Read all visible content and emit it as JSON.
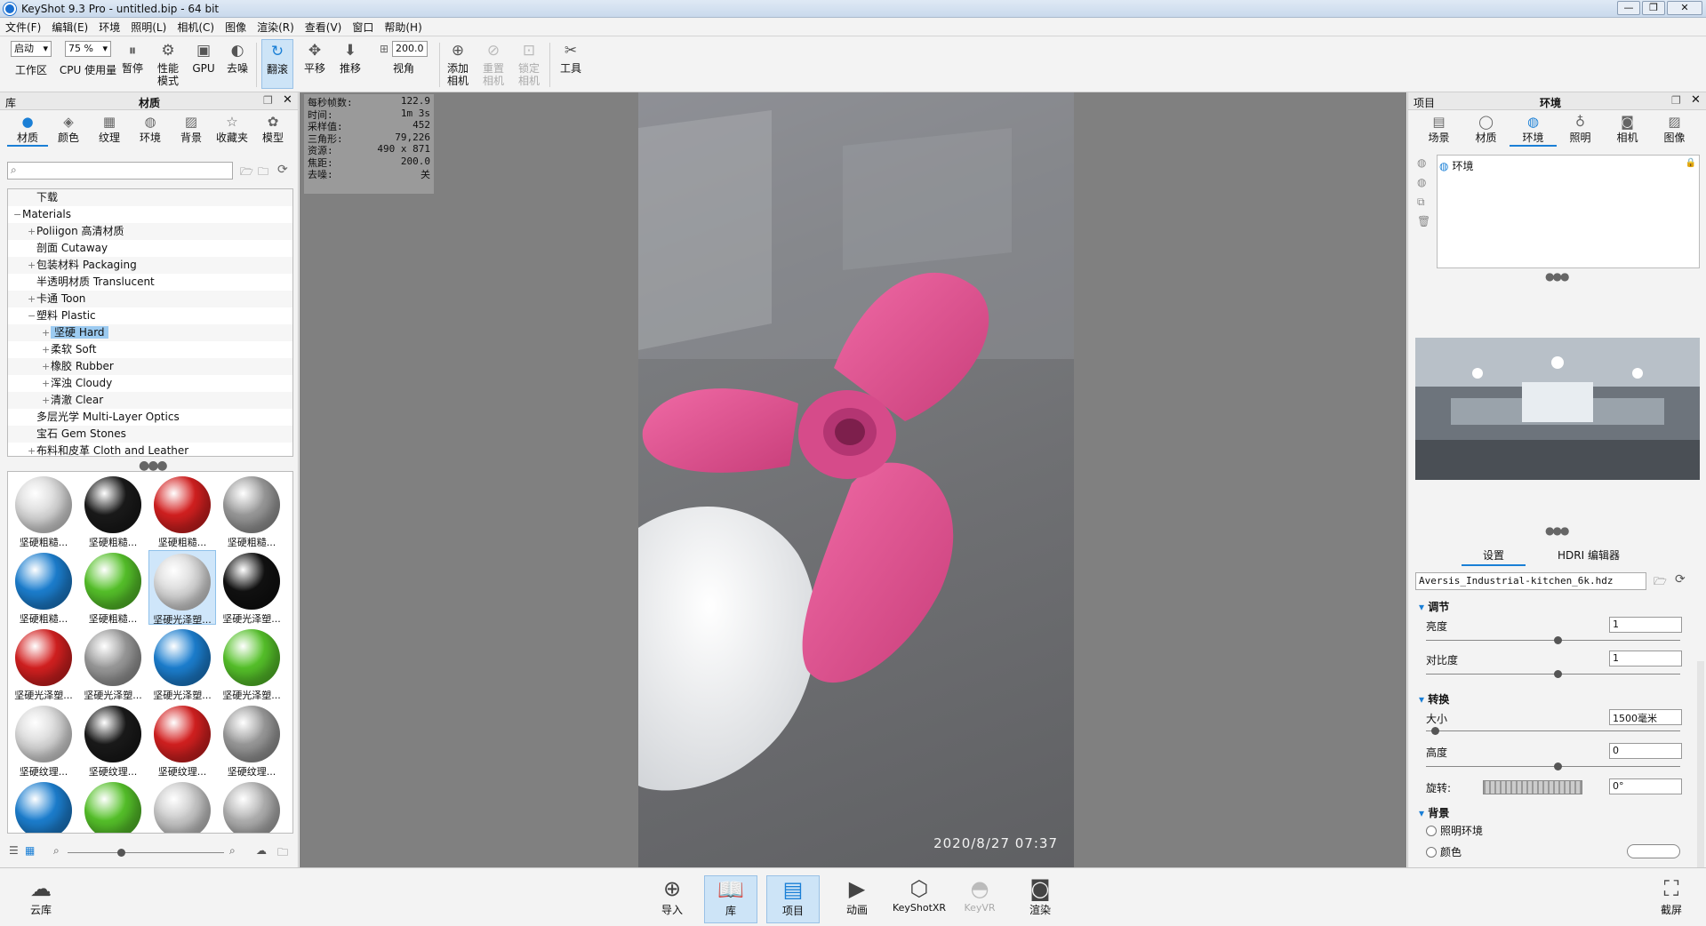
{
  "window": {
    "title": "KeyShot 9.3 Pro  - untitled.bip  - 64 bit",
    "minimize": "—",
    "restore": "❐",
    "close": "✕"
  },
  "menu": [
    "文件(F)",
    "编辑(E)",
    "环境",
    "照明(L)",
    "相机(C)",
    "图像",
    "渲染(R)",
    "查看(V)",
    "窗口",
    "帮助(H)"
  ],
  "toolbar": {
    "workspace_select": "启动",
    "workspace_label": "工作区",
    "cpu_select": "75 %",
    "cpu_label": "CPU 使用量",
    "pause_label": "暂停",
    "perf_label": "性能模式",
    "gpu_label": "GPU",
    "denoise_label": "去噪",
    "tumble_label": "翻滚",
    "pan_label": "平移",
    "dolly_label": "推移",
    "fov_value": "200.0",
    "fov_label": "视角",
    "add_cam_label": "添加相机",
    "reset_cam_label": "重置相机",
    "lock_cam_label": "锁定相机",
    "tools_label": "工具"
  },
  "library": {
    "panel_title": "库",
    "tab_title": "材质",
    "tabs": [
      "材质",
      "颜色",
      "纹理",
      "环境",
      "背景",
      "收藏夹",
      "模型"
    ],
    "tree": [
      {
        "label": "下载",
        "indent": 1,
        "pm": ""
      },
      {
        "label": "Materials",
        "indent": 0,
        "pm": "−"
      },
      {
        "label": "Poliigon 高清材质",
        "indent": 1,
        "pm": "+"
      },
      {
        "label": "剖面 Cutaway",
        "indent": 1,
        "pm": ""
      },
      {
        "label": "包装材料 Packaging",
        "indent": 1,
        "pm": "+"
      },
      {
        "label": "半透明材质 Translucent",
        "indent": 1,
        "pm": ""
      },
      {
        "label": "卡通 Toon",
        "indent": 1,
        "pm": "+"
      },
      {
        "label": "塑料 Plastic",
        "indent": 1,
        "pm": "−"
      },
      {
        "label": "坚硬 Hard",
        "indent": 2,
        "pm": "+",
        "selected": true
      },
      {
        "label": "柔软 Soft",
        "indent": 2,
        "pm": "+"
      },
      {
        "label": "橡胶 Rubber",
        "indent": 2,
        "pm": "+"
      },
      {
        "label": "浑浊 Cloudy",
        "indent": 2,
        "pm": "+"
      },
      {
        "label": "清澈 Clear",
        "indent": 2,
        "pm": "+"
      },
      {
        "label": "多层光学 Multi-Layer Optics",
        "indent": 1,
        "pm": ""
      },
      {
        "label": "宝石 Gem Stones",
        "indent": 1,
        "pm": ""
      },
      {
        "label": "布料和皮革 Cloth and Leather",
        "indent": 1,
        "pm": "+"
      }
    ],
    "thumbs": [
      {
        "label": "坚硬粗糙...",
        "color": "#d9d9d9"
      },
      {
        "label": "坚硬粗糙...",
        "color": "#1a1a1a"
      },
      {
        "label": "坚硬粗糙...",
        "color": "#d42020"
      },
      {
        "label": "坚硬粗糙...",
        "color": "#9a9a9a"
      },
      {
        "label": "坚硬粗糙...",
        "color": "#1c7fd0"
      },
      {
        "label": "坚硬粗糙...",
        "color": "#56c22a"
      },
      {
        "label": "坚硬光泽塑...",
        "color": "#d9d9d9",
        "selected": true
      },
      {
        "label": "坚硬光泽塑...",
        "color": "#111111"
      },
      {
        "label": "坚硬光泽塑...",
        "color": "#d42020"
      },
      {
        "label": "坚硬光泽塑...",
        "color": "#9a9a9a"
      },
      {
        "label": "坚硬光泽塑...",
        "color": "#1c7fd0"
      },
      {
        "label": "坚硬光泽塑...",
        "color": "#56c22a"
      },
      {
        "label": "坚硬纹理...",
        "color": "#d9d9d9"
      },
      {
        "label": "坚硬纹理...",
        "color": "#1a1a1a"
      },
      {
        "label": "坚硬纹理...",
        "color": "#d42020"
      },
      {
        "label": "坚硬纹理...",
        "color": "#9a9a9a"
      },
      {
        "label": "",
        "color": "#1c7fd0"
      },
      {
        "label": "",
        "color": "#56c22a"
      },
      {
        "label": "",
        "color": "#c8c8c8"
      },
      {
        "label": "",
        "color": "#b0b0b0"
      }
    ]
  },
  "stats": [
    {
      "k": "每秒帧数:",
      "v": "122.9"
    },
    {
      "k": "时间:",
      "v": "1m 3s"
    },
    {
      "k": "采样值:",
      "v": "452"
    },
    {
      "k": "三角形:",
      "v": "79,226"
    },
    {
      "k": "资源:",
      "v": "490 x 871"
    },
    {
      "k": "焦距:",
      "v": "200.0"
    },
    {
      "k": "去噪:",
      "v": "关"
    }
  ],
  "viewport": {
    "timestamp": "2020/8/27  07:37"
  },
  "project": {
    "panel_title": "项目",
    "tab_title": "环境",
    "tabs": [
      "场景",
      "材质",
      "环境",
      "照明",
      "相机",
      "图像"
    ],
    "env_item": "环境",
    "subtabs": [
      "设置",
      "HDRI 编辑器"
    ],
    "hdri_file": "Aversis_Industrial-kitchen_6k.hdz",
    "sections": {
      "adjust": "调节",
      "transform": "转换",
      "background": "背景"
    },
    "brightness_label": "亮度",
    "brightness_value": "1",
    "contrast_label": "对比度",
    "contrast_value": "1",
    "size_label": "大小",
    "size_value": "1500毫米",
    "height_label": "高度",
    "height_value": "0",
    "rotation_label": "旋转:",
    "rotation_value": "0°",
    "bg_lighting": "照明环境",
    "bg_color": "颜色"
  },
  "bottom": {
    "cloud": "云库",
    "import": "导入",
    "library": "库",
    "project": "项目",
    "animation": "动画",
    "keyshotxr": "KeyShotXR",
    "keyvr": "KeyVR",
    "render": "渲染",
    "screenshot": "截屏"
  },
  "colors": {
    "accent": "#1a7fd6",
    "propeller": "#e0528f"
  }
}
